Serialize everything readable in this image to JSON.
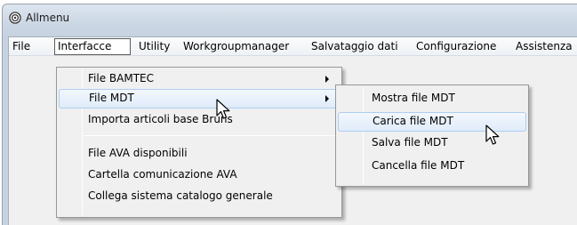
{
  "window": {
    "title": "Allmenu",
    "icon": "app-settings-icon"
  },
  "menubar": {
    "items": [
      {
        "label": "File"
      },
      {
        "label": "Interfacce"
      },
      {
        "label": "Utility"
      },
      {
        "label": "Workgroupmanager"
      },
      {
        "label": "Salvataggio dati"
      },
      {
        "label": "Configurazione"
      },
      {
        "label": "Assistenza"
      }
    ]
  },
  "interfacce_menu": {
    "items": [
      {
        "label": "File BAMTEC",
        "submenu": true
      },
      {
        "label": "File MDT",
        "submenu": true
      },
      {
        "label": "Importa articoli base Bruns"
      },
      {
        "label": "File AVA disponibili"
      },
      {
        "label": "Cartella comunicazione AVA"
      },
      {
        "label": "Collega sistema catalogo generale"
      }
    ]
  },
  "mdt_submenu": {
    "items": [
      {
        "label": "Mostra file MDT"
      },
      {
        "label": "Carica file MDT"
      },
      {
        "label": "Salva file MDT"
      },
      {
        "label": "Cancella file MDT"
      }
    ]
  },
  "colors": {
    "highlight_border": "#aecdf2",
    "menu_bg": "#f0f0f0"
  }
}
